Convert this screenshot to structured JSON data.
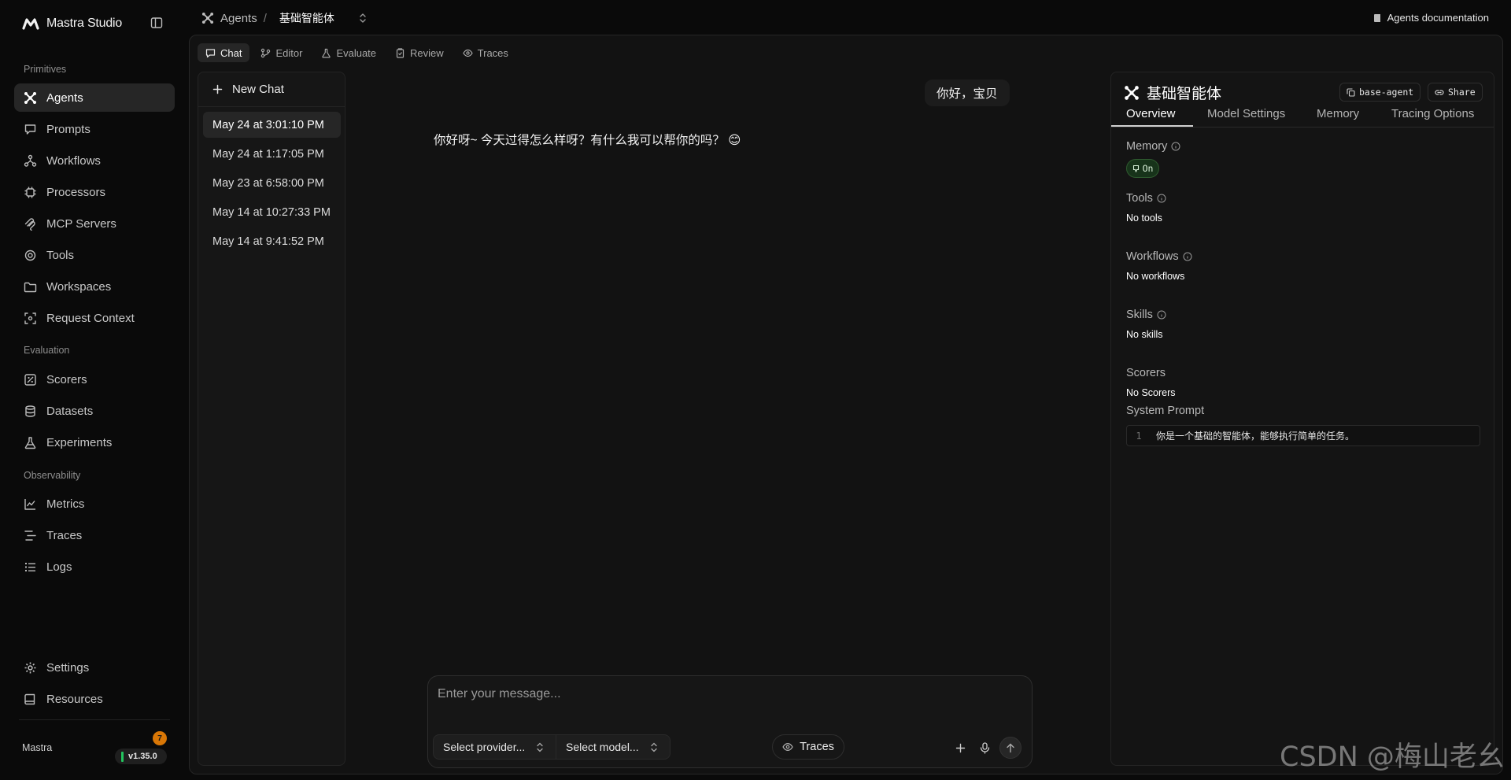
{
  "brand": {
    "name": "Mastra Studio"
  },
  "sidebar": {
    "sections": {
      "primitives": "Primitives",
      "evaluation": "Evaluation",
      "observability": "Observability"
    },
    "items": [
      {
        "label": "Agents",
        "icon": "agents-icon"
      },
      {
        "label": "Prompts",
        "icon": "prompts-icon"
      },
      {
        "label": "Workflows",
        "icon": "workflows-icon"
      },
      {
        "label": "Processors",
        "icon": "processors-icon"
      },
      {
        "label": "MCP Servers",
        "icon": "mcp-icon"
      },
      {
        "label": "Tools",
        "icon": "tools-icon"
      },
      {
        "label": "Workspaces",
        "icon": "folder-icon"
      },
      {
        "label": "Request Context",
        "icon": "context-icon"
      },
      {
        "label": "Scorers",
        "icon": "scorers-icon"
      },
      {
        "label": "Datasets",
        "icon": "database-icon"
      },
      {
        "label": "Experiments",
        "icon": "flask-icon"
      },
      {
        "label": "Metrics",
        "icon": "chart-icon"
      },
      {
        "label": "Traces",
        "icon": "traces-icon"
      },
      {
        "label": "Logs",
        "icon": "logs-icon"
      }
    ],
    "footer": {
      "settings": "Settings",
      "resources": "Resources",
      "org": "Mastra",
      "version": "v1.35.0",
      "notifications": "7"
    }
  },
  "topbar": {
    "breadcrumb_root": "Agents",
    "breadcrumb_sep": "/",
    "breadcrumb_current": "基础智能体",
    "docs_link": "Agents documentation"
  },
  "tabs": [
    "Chat",
    "Editor",
    "Evaluate",
    "Review",
    "Traces"
  ],
  "threads": {
    "new_chat": "New Chat",
    "items": [
      "May 24 at 3:01:10 PM",
      "May 24 at 1:17:05 PM",
      "May 23 at 6:58:00 PM",
      "May 14 at 10:27:33 PM",
      "May 14 at 9:41:52 PM"
    ]
  },
  "conversation": {
    "user_message": "你好，宝贝",
    "assistant_message": "你好呀~ 今天过得怎么样呀？有什么我可以帮你的吗？ 😊"
  },
  "composer": {
    "placeholder": "Enter your message...",
    "provider": "Select provider...",
    "model": "Select model...",
    "traces": "Traces"
  },
  "agent": {
    "name": "基础智能体",
    "id_button": "base-agent",
    "share_button": "Share",
    "tabs": [
      "Overview",
      "Model Settings",
      "Memory",
      "Tracing Options"
    ],
    "memory_label": "Memory",
    "memory_status": "On",
    "tools_label": "Tools",
    "tools_value": "No tools",
    "workflows_label": "Workflows",
    "workflows_value": "No workflows",
    "skills_label": "Skills",
    "skills_value": "No skills",
    "scorers_label": "Scorers",
    "scorers_value": "No Scorers",
    "system_prompt_label": "System Prompt",
    "system_prompt_line_no": "1",
    "system_prompt": "你是一个基础的智能体，能够执行简单的任务。"
  },
  "watermark": "CSDN @梅山老幺",
  "colors": {
    "background": "#0a0a0a",
    "panel": "#121212",
    "active_item": "#262626",
    "memory_on": "#17331a",
    "version_indicator": "#22c55e",
    "badge": "#d97706"
  }
}
